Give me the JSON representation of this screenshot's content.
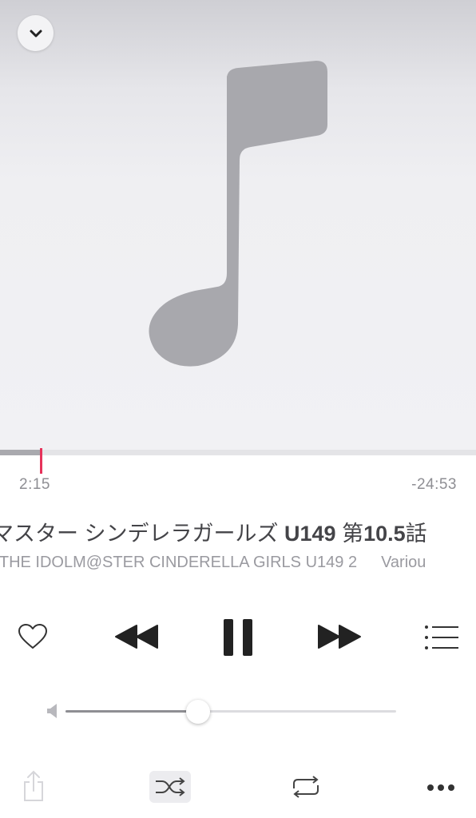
{
  "player": {
    "elapsed": "2:15",
    "remaining": "-24:53",
    "progress_fraction": 0.084,
    "title_prefix": "マスター シンデレラガールズ ",
    "title_bold1": "U149",
    "title_mid": " 第",
    "title_bold2": "10.5",
    "title_suffix": "話",
    "subtitle": "- THE IDOLM@STER CINDERELLA GIRLS U149 2",
    "artist": "Variou",
    "volume_fraction": 0.4,
    "accent_color": "#e6325a"
  },
  "icons": {
    "collapse": "chevron-down-icon",
    "artwork": "music-note-icon",
    "love": "heart-icon",
    "previous": "rewind-icon",
    "pause": "pause-icon",
    "next": "fast-forward-icon",
    "queue": "list-icon",
    "volume_low": "speaker-icon",
    "share": "share-icon",
    "shuffle": "shuffle-icon",
    "repeat": "repeat-icon",
    "more": "more-icon"
  }
}
